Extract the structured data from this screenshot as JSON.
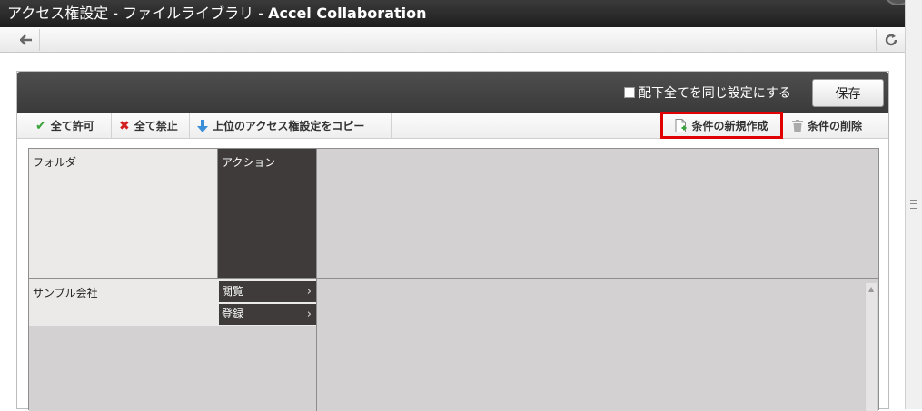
{
  "window": {
    "title_plain": "アクセス権設定 - ファイルライブラリ - ",
    "title_bold": "Accel Collaboration"
  },
  "nav": {
    "back_icon": "arrow-left-icon",
    "reload_icon": "reload-icon"
  },
  "header": {
    "apply_subfolders_label": "配下全てを同じ設定にする",
    "apply_subfolders_checked": false,
    "save_label": "保存"
  },
  "toolbar": {
    "allow_all": "全て許可",
    "deny_all": "全て禁止",
    "copy_parent": "上位のアクセス権設定をコピー",
    "new_condition": "条件の新規作成",
    "delete_condition": "条件の削除"
  },
  "grid": {
    "folder_header": "フォルダ",
    "action_header": "アクション",
    "rows": [
      {
        "folder": "サンプル会社",
        "actions": [
          "閲覧",
          "登録"
        ]
      }
    ]
  },
  "colors": {
    "highlight": "#e00000",
    "header_bg": "#3f3b3b",
    "allow": "#3aa33a",
    "deny": "#d32020"
  }
}
